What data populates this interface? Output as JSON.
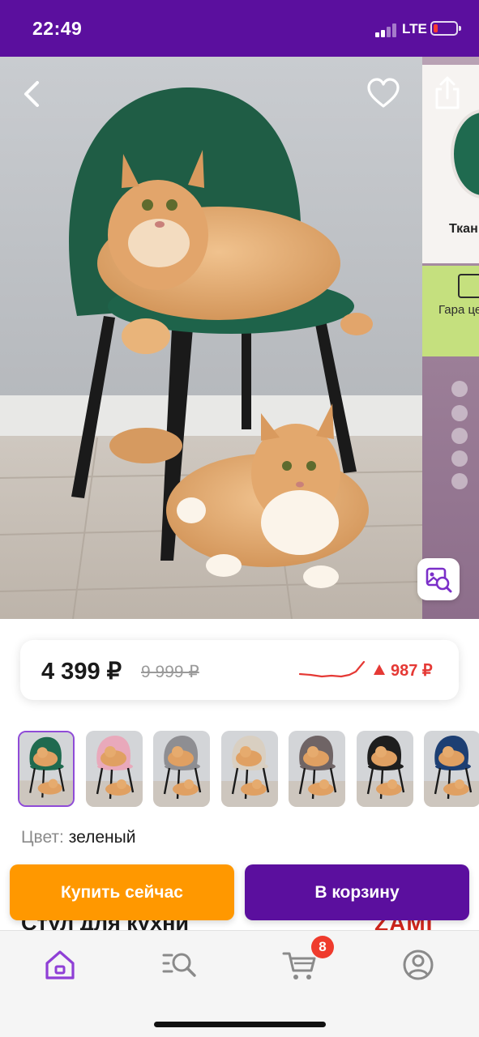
{
  "status_bar": {
    "time": "22:49",
    "network": "LTE",
    "battery_level": 0.2,
    "bg_color": "#5b0f9e"
  },
  "gallery": {
    "next_slide_text_1": "Ткан пр",
    "next_slide_text_2": "Гара целос досто",
    "icons": [
      "back-icon",
      "heart-icon",
      "share-icon",
      "visual-search-icon"
    ]
  },
  "price": {
    "current": "4 399 ₽",
    "old": "9 999 ₽",
    "change": "987 ₽",
    "change_direction": "up",
    "accent_color": "#e53935"
  },
  "thumbnails": [
    {
      "chair_color": "#1f6a4f",
      "selected": true
    },
    {
      "chair_color": "#e9a9bb",
      "selected": false
    },
    {
      "chair_color": "#8e8e92",
      "selected": false
    },
    {
      "chair_color": "#d9cfc1",
      "selected": false
    },
    {
      "chair_color": "#6f6465",
      "selected": false
    },
    {
      "chair_color": "#1e1e1e",
      "selected": false
    },
    {
      "chair_color": "#1d3f73",
      "selected": false
    }
  ],
  "color_option": {
    "label": "Цвет:",
    "value": "зеленый"
  },
  "product": {
    "title_peek": "Стул для кухни",
    "brand_peek": "ZAMI"
  },
  "actions": {
    "buy_now": "Купить сейчас",
    "add_to_cart": "В корзину",
    "buy_color": "#ff9800",
    "cart_color": "#5b0f9e"
  },
  "tab_bar": {
    "tabs": [
      "home-icon",
      "catalog-search-icon",
      "cart-icon",
      "profile-icon"
    ],
    "cart_badge": "8",
    "active_color": "#8f3fd6"
  }
}
